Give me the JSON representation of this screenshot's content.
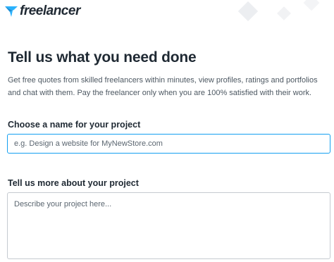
{
  "brand": {
    "name": "freelancer",
    "logo_color": "#29b2fe"
  },
  "page": {
    "title": "Tell us what you need done",
    "subtitle": "Get free quotes from skilled freelancers within minutes, view profiles, ratings and portfolios and chat with them. Pay the freelancer only when you are 100% satisfied with their work."
  },
  "form": {
    "name_label": "Choose a name for your project",
    "name_placeholder": "e.g. Design a website for MyNewStore.com",
    "name_value": "",
    "description_label": "Tell us more about your project",
    "description_placeholder": "Describe your project here...",
    "description_value": ""
  },
  "colors": {
    "focus_border": "#139ff0",
    "text_primary": "#1f2933",
    "text_secondary": "#4d5862"
  }
}
